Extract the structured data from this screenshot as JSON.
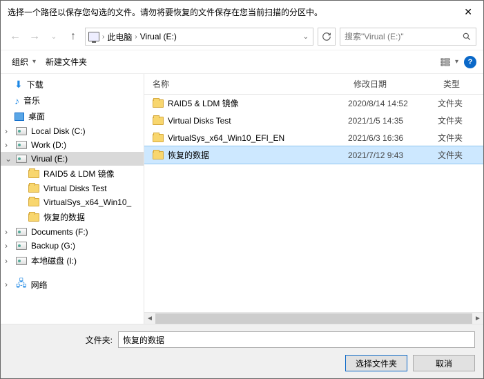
{
  "title": "选择一个路径以保存您勾选的文件。请勿将要恢复的文件保存在您当前扫描的分区中。",
  "path": {
    "root": "此电脑",
    "current": "Virual (E:)"
  },
  "search": {
    "placeholder": "搜索\"Virual (E:)\""
  },
  "toolbar": {
    "organize": "组织",
    "newfolder": "新建文件夹"
  },
  "tree": {
    "downloads": "下载",
    "music": "音乐",
    "desktop": "桌面",
    "localc": "Local Disk (C:)",
    "workd": "Work (D:)",
    "viruale": "Virual (E:)",
    "raid5": "RAID5 & LDM 镜像",
    "vdisks": "Virtual Disks Test",
    "vsys": "VirtualSys_x64_Win10_",
    "recov": "恢复的数据",
    "docsf": "Documents (F:)",
    "backupg": "Backup (G:)",
    "locali": "本地磁盘 (I:)",
    "network": "网络"
  },
  "list": {
    "head": {
      "name": "名称",
      "date": "修改日期",
      "type": "类型"
    },
    "rows": [
      {
        "name": "RAID5 & LDM 镜像",
        "date": "2020/8/14 14:52",
        "type": "文件夹",
        "sel": false
      },
      {
        "name": "Virtual Disks Test",
        "date": "2021/1/5 14:35",
        "type": "文件夹",
        "sel": false
      },
      {
        "name": "VirtualSys_x64_Win10_EFI_EN",
        "date": "2021/6/3 16:36",
        "type": "文件夹",
        "sel": false
      },
      {
        "name": "恢复的数据",
        "date": "2021/7/12 9:43",
        "type": "文件夹",
        "sel": true
      }
    ]
  },
  "footer": {
    "label": "文件夹:",
    "value": "恢复的数据",
    "select": "选择文件夹",
    "cancel": "取消"
  }
}
